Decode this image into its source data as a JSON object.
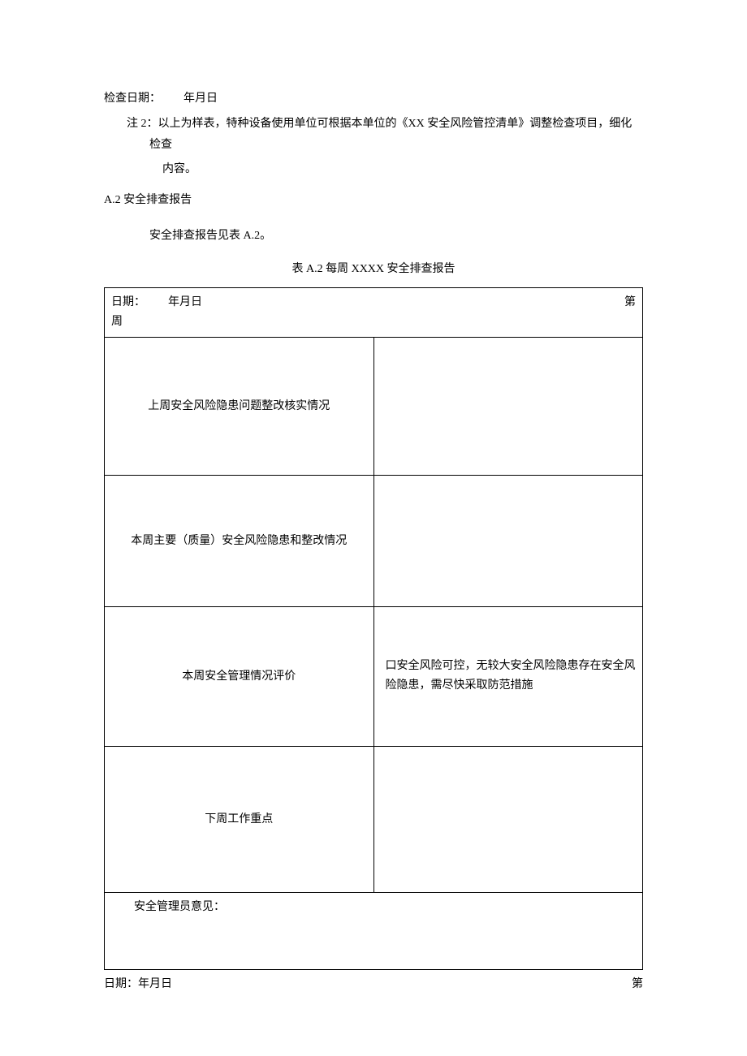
{
  "top": {
    "checkDate": "检查日期：  年月日",
    "note": "注 2：以上为样表，特种设备使用单位可根据本单位的《XX 安全风险管控清单》调整检查项目，细化检查",
    "noteCont": "内容。"
  },
  "section": {
    "heading": "A.2 安全排查报告",
    "seeTable": "安全排查报告见表 A.2。",
    "caption": "表 A.2 每周 XXXX 安全排查报告"
  },
  "table": {
    "headerDate": "日期：  年月日",
    "headerWeekRight": "第",
    "headerWeekBelow": "周",
    "row1Label": "上周安全风险隐患问题整改核实情况",
    "row2Label": "本周主要（质量）安全风险隐患和整改情况",
    "row3Label": "本周安全管理情况评价",
    "row3Content": "口安全风险可控，无较大安全风险隐患存在安全风险隐患，需尽快采取防范措施",
    "row4Label": "下周工作重点",
    "row5Label": "安全管理员意见："
  },
  "footer": {
    "left": "日期：年月日",
    "right": "第"
  }
}
